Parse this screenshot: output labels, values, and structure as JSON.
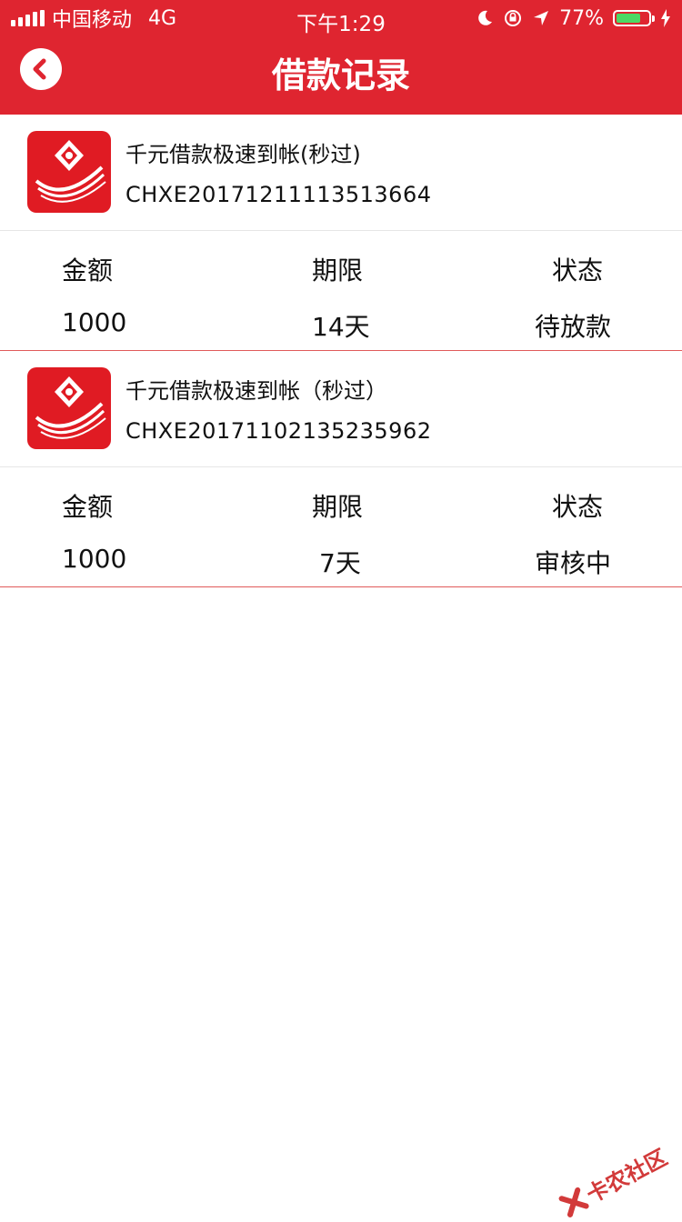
{
  "status_bar": {
    "carrier": "中国移动",
    "network": "4G",
    "time": "下午1:29",
    "battery_percent": "77%",
    "battery_level": 0.77,
    "colors": {
      "background": "#df2530",
      "battery_fill": "#4cd964"
    }
  },
  "nav": {
    "title": "借款记录",
    "back_icon": "chevron-left-icon"
  },
  "records": [
    {
      "name": "千元借款极速到帐(秒过)",
      "code": "CHXE20171211113513664",
      "labels": {
        "amount": "金额",
        "term": "期限",
        "status": "状态"
      },
      "values": {
        "amount": "1000",
        "term": "14天",
        "status": "待放款"
      }
    },
    {
      "name": "千元借款极速到帐（秒过）",
      "code": "CHXE20171102135235962",
      "labels": {
        "amount": "金额",
        "term": "期限",
        "status": "状态"
      },
      "values": {
        "amount": "1000",
        "term": "7天",
        "status": "审核中"
      }
    }
  ],
  "watermark": {
    "text": "卡农社区"
  },
  "colors": {
    "brand_red": "#df2530",
    "divider_red": "#e05a5a"
  }
}
